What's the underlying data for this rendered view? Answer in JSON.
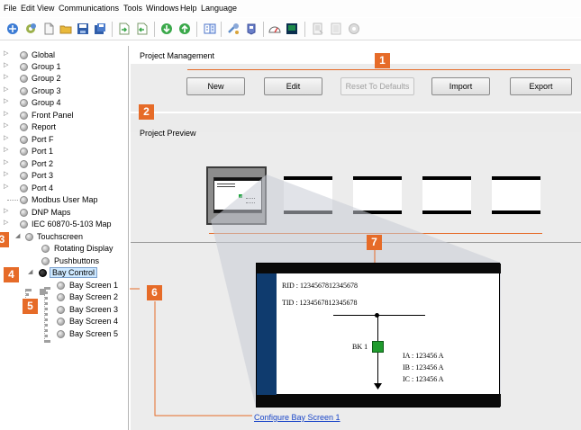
{
  "menu": [
    "File",
    "Edit",
    "View",
    "Communications",
    "Tools",
    "Windows",
    "Help",
    "Language"
  ],
  "toolbar_icons": [
    {
      "name": "connect-icon",
      "color": "#3b7bd4"
    },
    {
      "name": "settings-gear-icon",
      "color": "#8aa23a"
    },
    {
      "name": "new-file-icon",
      "color": "#e8e8e8"
    },
    {
      "name": "open-folder-icon",
      "color": "#e9b93b"
    },
    {
      "name": "save-icon",
      "color": "#2f5da8"
    },
    {
      "name": "save-all-icon",
      "color": "#2f5da8"
    },
    {
      "name": "import-icon",
      "color": "#4caf50"
    },
    {
      "name": "export-icon",
      "color": "#4caf50"
    },
    {
      "name": "download-icon",
      "color": "#3aa84a"
    },
    {
      "name": "upload-icon",
      "color": "#3aa84a"
    },
    {
      "name": "compare-icon",
      "color": "#4b74c9"
    },
    {
      "name": "tools-icon",
      "color": "#5b8ac9"
    },
    {
      "name": "device-icon",
      "color": "#6a7fc9"
    },
    {
      "name": "meter-icon",
      "color": "#dc3b3b"
    },
    {
      "name": "terminal-icon",
      "color": "#0c2f4f"
    },
    {
      "name": "report-icon",
      "color": "#bfbfbf"
    },
    {
      "name": "document-icon",
      "color": "#c8c8c8"
    },
    {
      "name": "disabled-gear-icon",
      "color": "#c8c8c8"
    }
  ],
  "tree": [
    {
      "label": "Global",
      "expander": "▷",
      "level": 0
    },
    {
      "label": "Group 1",
      "expander": "▷",
      "level": 0
    },
    {
      "label": "Group 2",
      "expander": "▷",
      "level": 0
    },
    {
      "label": "Group 3",
      "expander": "▷",
      "level": 0
    },
    {
      "label": "Group 4",
      "expander": "▷",
      "level": 0
    },
    {
      "label": "Front Panel",
      "expander": "▷",
      "level": 0
    },
    {
      "label": "Report",
      "expander": "▷",
      "level": 0
    },
    {
      "label": "Port F",
      "expander": "▷",
      "level": 0
    },
    {
      "label": "Port 1",
      "expander": "▷",
      "level": 0
    },
    {
      "label": "Port 2",
      "expander": "▷",
      "level": 0
    },
    {
      "label": "Port 3",
      "expander": "▷",
      "level": 0
    },
    {
      "label": "Port 4",
      "expander": "▷",
      "level": 0
    },
    {
      "label": "Modbus User Map",
      "expander": "",
      "level": 0
    },
    {
      "label": "DNP Maps",
      "expander": "▷",
      "level": 0
    },
    {
      "label": "IEC 60870-5-103 Map",
      "expander": "▷",
      "level": 0
    },
    {
      "label": "Touchscreen",
      "expander": "◢",
      "level": 0
    },
    {
      "label": "Rotating Display",
      "expander": "",
      "level": 1
    },
    {
      "label": "Pushbuttons",
      "expander": "",
      "level": 1
    },
    {
      "label": "Bay Control",
      "expander": "◢",
      "level": 1,
      "selected": true
    },
    {
      "label": "Bay Screen 1",
      "expander": "",
      "level": 2
    },
    {
      "label": "Bay Screen 2",
      "expander": "",
      "level": 2
    },
    {
      "label": "Bay Screen 3",
      "expander": "",
      "level": 2
    },
    {
      "label": "Bay Screen 4",
      "expander": "",
      "level": 2
    },
    {
      "label": "Bay Screen 5",
      "expander": "",
      "level": 2
    }
  ],
  "project_management": {
    "title": "Project Management",
    "buttons": [
      {
        "label": "New",
        "enabled": true
      },
      {
        "label": "Edit",
        "enabled": true
      },
      {
        "label": "Reset To Defaults",
        "enabled": false
      },
      {
        "label": "Import",
        "enabled": true
      },
      {
        "label": "Export",
        "enabled": true
      }
    ]
  },
  "project_preview": {
    "title": "Project Preview"
  },
  "callouts": [
    "1",
    "2",
    "3",
    "4",
    "5",
    "6",
    "7"
  ],
  "accent_color": "#e66b28",
  "detail": {
    "rid": "RID : 1234567812345678",
    "tid": "TID : 1234567812345678",
    "breaker": "BK 1",
    "ia": "IA :  123456  A",
    "ib": "IB :  123456  A",
    "ic": "IC :  123456  A"
  },
  "config_link": "Configure  Bay Screen 1"
}
